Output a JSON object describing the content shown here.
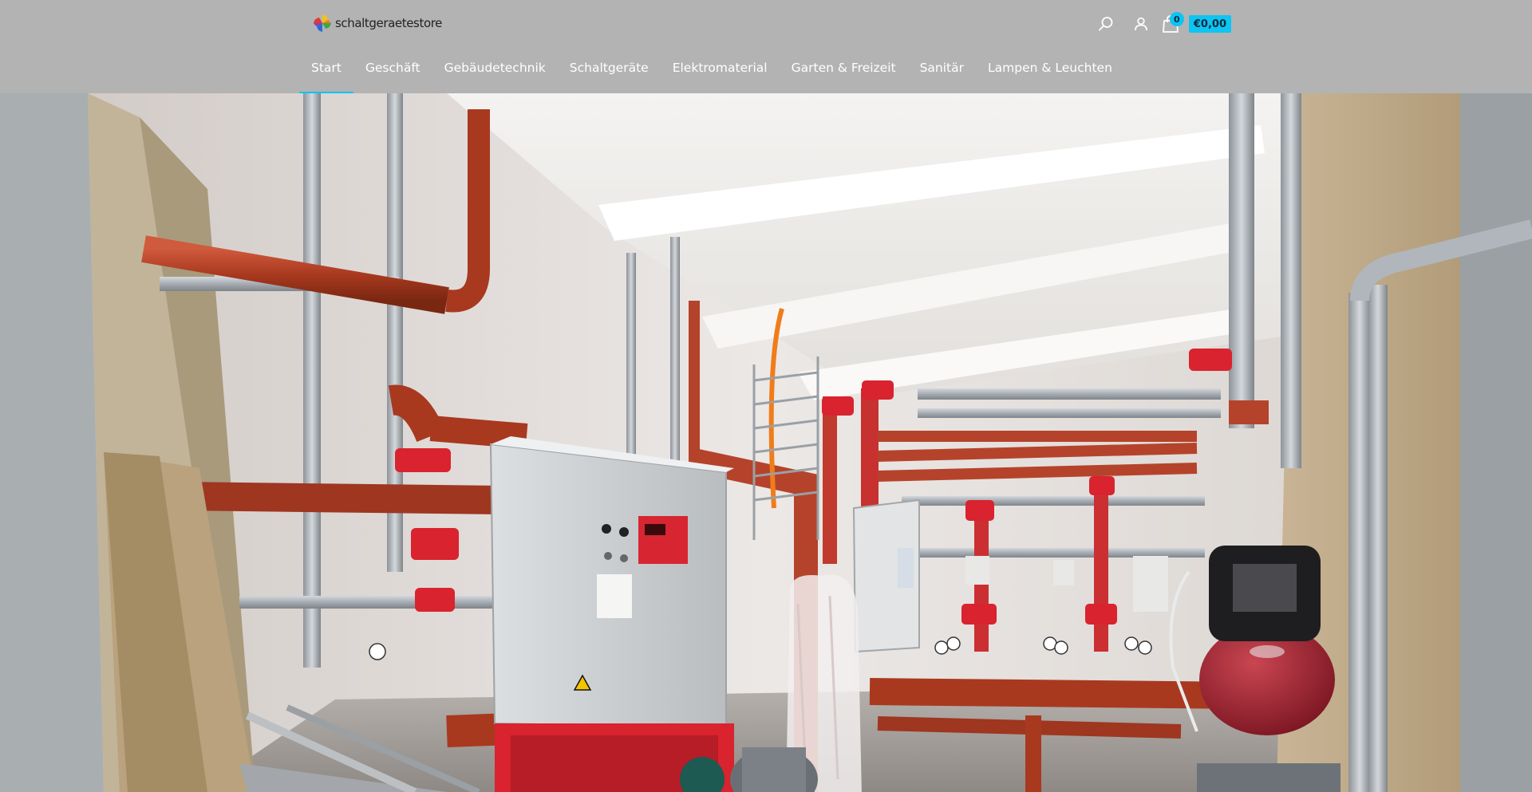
{
  "header": {
    "logo_text": "schaltgeraetestore"
  },
  "actions": {
    "search_icon": "search-icon",
    "account_icon": "user-icon",
    "cart_icon": "shopping-bag-icon",
    "cart_count": "0",
    "cart_total": "€0,00"
  },
  "nav": {
    "items": [
      {
        "label": "Start"
      },
      {
        "label": "Geschäft"
      },
      {
        "label": "Gebäudetechnik"
      },
      {
        "label": "Schaltgeräte"
      },
      {
        "label": "Elektromaterial"
      },
      {
        "label": "Garten & Freizeit"
      },
      {
        "label": "Sanitär"
      },
      {
        "label": "Lampen & Leuchten"
      }
    ],
    "active_index": 0
  },
  "colors": {
    "header_bg": "#b3b3b3",
    "accent": "#0dc4f2",
    "pipe_red": "#b5432b",
    "fire_red": "#d9232e"
  }
}
